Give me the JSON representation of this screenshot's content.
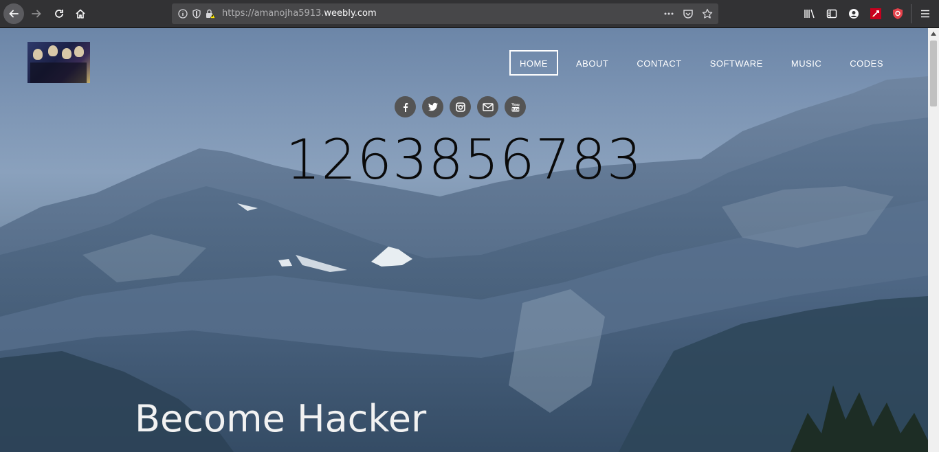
{
  "browser": {
    "url_prefix": "https://amanojha5913.",
    "url_host": "weebly.com",
    "icons": [
      "back-icon",
      "forward-icon",
      "reload-icon",
      "home-icon",
      "info-icon",
      "tracking-shield-icon",
      "insecure-lock-icon",
      "page-actions-icon",
      "pocket-icon",
      "bookmark-star-icon",
      "library-icon",
      "sidebar-icon",
      "account-icon",
      "extension-icon",
      "ublock-icon",
      "menu-icon"
    ]
  },
  "site": {
    "nav": [
      {
        "label": "HOME",
        "active": true
      },
      {
        "label": "ABOUT"
      },
      {
        "label": "CONTACT"
      },
      {
        "label": "SOFTWARE"
      },
      {
        "label": "MUSIC"
      },
      {
        "label": "CODES"
      }
    ],
    "social": [
      "facebook-icon",
      "twitter-icon",
      "instagram-icon",
      "mail-icon",
      "youtube-icon"
    ],
    "counter": "1263856783",
    "hero_title": "Become Hacker"
  }
}
